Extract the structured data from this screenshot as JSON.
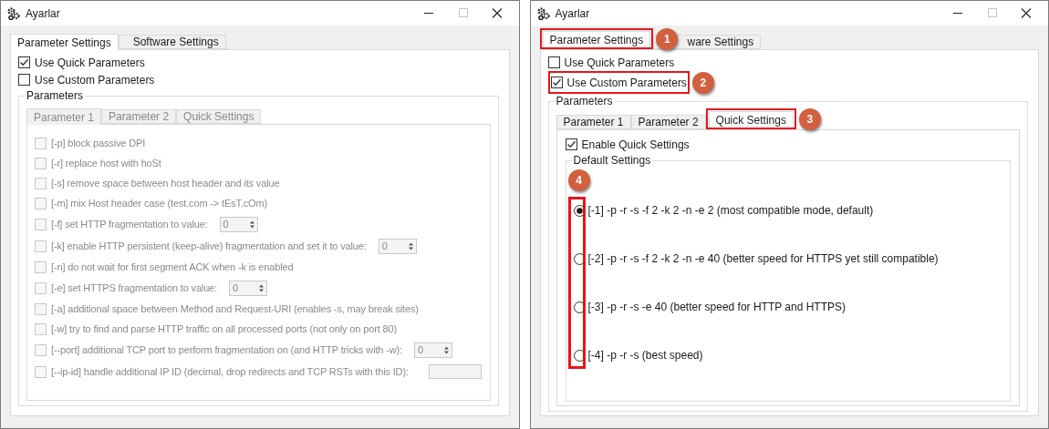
{
  "windows": [
    {
      "title": "Ayarlar",
      "tabs": [
        {
          "label": "Parameter Settings",
          "selected": true
        },
        {
          "label": "Software Settings",
          "selected": false
        }
      ],
      "modes": [
        {
          "label": "Use Quick Parameters",
          "checked": true
        },
        {
          "label": "Use Custom Parameters",
          "checked": false
        }
      ],
      "parameters": {
        "title": "Parameters",
        "disabled": true,
        "tabs": [
          {
            "label": "Parameter 1",
            "selected": true
          },
          {
            "label": "Parameter 2",
            "selected": false
          },
          {
            "label": "Quick Settings",
            "selected": false
          }
        ],
        "pane": {
          "kind": "list",
          "options": [
            {
              "label": "[-p] block passive DPI",
              "checked": false
            },
            {
              "label": "[-r] replace host with hoSt",
              "checked": false
            },
            {
              "label": "[-s] remove space between host header and its value",
              "checked": false
            },
            {
              "label": "[-m] mix Host header case (test.com -> tEsT.cOm)",
              "checked": false
            },
            {
              "label": "[-f] set HTTP fragmentation to value:",
              "checked": false,
              "field": {
                "kind": "spin",
                "value": "0"
              }
            },
            {
              "label": "[-k] enable HTTP persistent (keep-alive) fragmentation and set it to value:",
              "checked": false,
              "field": {
                "kind": "spin",
                "value": "0"
              }
            },
            {
              "label": "[-n] do not wait for first segment ACK when -k is enabled",
              "checked": false
            },
            {
              "label": "[-e] set HTTPS fragmentation to value:",
              "checked": false,
              "field": {
                "kind": "spin",
                "value": "0"
              }
            },
            {
              "label": "[-a] additional space between Method and Request-URI (enables -s, may break sites)",
              "checked": false
            },
            {
              "label": "[-w] try to find and parse HTTP traffic on all processed ports (not only on port 80)",
              "checked": false
            },
            {
              "label": "[--port] additional TCP port to perform fragmentation on (and HTTP tricks with -w):",
              "checked": false,
              "field": {
                "kind": "spin",
                "value": "0"
              }
            },
            {
              "label": "[--ip-id] handle additional IP ID (decimal, drop redirects and TCP RSTs with this ID):",
              "checked": false,
              "field": {
                "kind": "text"
              }
            }
          ]
        }
      }
    },
    {
      "title": "Ayarlar",
      "tabs": [
        {
          "label": "Parameter Settings",
          "selected": true,
          "callout": "1"
        },
        {
          "label": "ware Settings",
          "selected": false
        }
      ],
      "modes": [
        {
          "label": "Use Quick Parameters",
          "checked": false
        },
        {
          "label": "Use Custom Parameters",
          "checked": true,
          "callout": "2"
        }
      ],
      "parameters": {
        "title": "Parameters",
        "disabled": false,
        "tabs": [
          {
            "label": "Parameter 1",
            "selected": false
          },
          {
            "label": "Parameter 2",
            "selected": false
          },
          {
            "label": "Quick Settings",
            "selected": true,
            "callout": "3"
          }
        ],
        "pane": {
          "kind": "quick",
          "enable": {
            "label": "Enable Quick Settings",
            "checked": true
          },
          "group_title": "Default Settings",
          "callout": "4",
          "presets": [
            {
              "label": "[-1] -p -r -s -f 2 -k 2 -n -e 2 (most compatible mode, default)",
              "selected": true
            },
            {
              "label": "[-2] -p -r -s -f 2 -k 2 -n -e 40 (better speed for HTTPS yet still compatible)",
              "selected": false
            },
            {
              "label": "[-3] -p -r -s -e 40 (better speed for HTTP and HTTPS)",
              "selected": false
            },
            {
              "label": "[-4] -p -r -s (best speed)",
              "selected": false
            }
          ]
        }
      }
    }
  ]
}
